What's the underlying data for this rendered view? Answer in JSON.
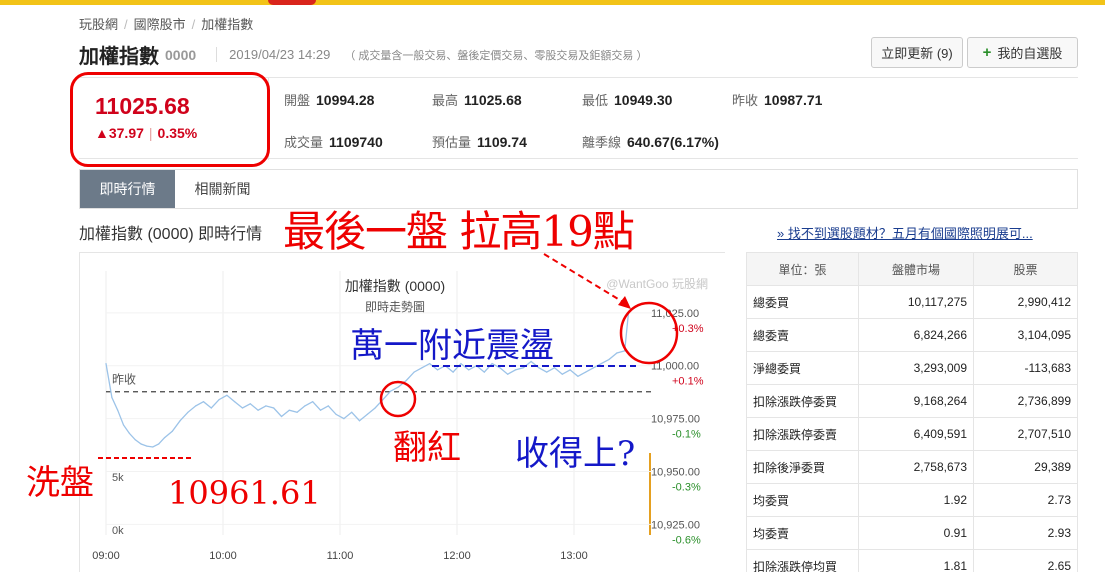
{
  "breadcrumb": [
    "玩股網",
    "國際股市",
    "加權指數"
  ],
  "header": {
    "name": "加權指數",
    "code": "0000",
    "datetime": "2019/04/23 14:29",
    "note": "（ 成交量含一般交易、盤後定價交易、零股交易及鉅額交易 ）",
    "refresh_label": "立即更新 (9)",
    "add_label": "我的自選股"
  },
  "quote": {
    "price": "11025.68",
    "change": "▲37.97",
    "change_pct": "0.35%",
    "open_label": "開盤",
    "open": "10994.28",
    "high_label": "最高",
    "high": "11025.68",
    "low_label": "最低",
    "low": "10949.30",
    "prev_label": "昨收",
    "prev": "10987.71",
    "volume_label": "成交量",
    "volume": "1109740",
    "est_label": "預估量",
    "est": "1109.74",
    "season_label": "離季線",
    "season": "640.67(6.17%)"
  },
  "tabs": [
    "即時行情",
    "相關新聞"
  ],
  "section_title": "加權指數 (0000) 即時行情",
  "promo_link": "» 找不到選股題材？五月有個國際照明展可...",
  "table": {
    "headers": [
      "單位：張",
      "盤體市場",
      "股票"
    ],
    "rows": [
      [
        "總委買",
        "10,117,275",
        "2,990,412"
      ],
      [
        "總委賣",
        "6,824,266",
        "3,104,095"
      ],
      [
        "淨總委買",
        "3,293,009",
        "-113,683"
      ],
      [
        "扣除漲跌停委買",
        "9,168,264",
        "2,736,899"
      ],
      [
        "扣除漲跌停委賣",
        "6,409,591",
        "2,707,510"
      ],
      [
        "扣除後淨委買",
        "2,758,673",
        "29,389"
      ],
      [
        "均委買",
        "1.92",
        "2.73"
      ],
      [
        "均委賣",
        "0.91",
        "2.93"
      ],
      [
        "扣除漲跌停均買",
        "1.81",
        "2.65"
      ]
    ]
  },
  "annotations": {
    "headline": "最後一盤 拉高19點",
    "range": "萬一附近震盪",
    "turn_red": "翻紅",
    "hold": "收得上?",
    "washout": "洗盤",
    "low_value": "10961.61"
  },
  "chart_data": {
    "type": "line",
    "title": "加權指數 (0000)",
    "subtitle": "即時走勢圖",
    "watermark": "@WantGoo 玩股網",
    "prev_close_label": "昨收",
    "prev_close": 10987.71,
    "x_ticks": [
      "09:00",
      "10:00",
      "11:00",
      "12:00",
      "13:00"
    ],
    "y_ticks": [
      {
        "value": 11025,
        "label": "11,025.00",
        "pct": "+0.3%"
      },
      {
        "value": 11000,
        "label": "11,000.00",
        "pct": "+0.1%"
      },
      {
        "value": 10975,
        "label": "10,975.00",
        "pct": "-0.1%"
      },
      {
        "value": 10950,
        "label": "10,950.00",
        "pct": "-0.3%"
      },
      {
        "value": 10925,
        "label": "10,925.00",
        "pct": "-0.6%"
      }
    ],
    "volume_ticks": [
      "5k",
      "0k"
    ],
    "ylim": [
      10920,
      11032
    ],
    "xlim_minutes": [
      0,
      280
    ],
    "series": [
      {
        "values": [
          [
            0,
            11001
          ],
          [
            3,
            10985
          ],
          [
            6,
            10979
          ],
          [
            9,
            10972
          ],
          [
            12,
            10968
          ],
          [
            15,
            10965
          ],
          [
            18,
            10963
          ],
          [
            21,
            10962
          ],
          [
            24,
            10961.61
          ],
          [
            27,
            10963
          ],
          [
            30,
            10966
          ],
          [
            34,
            10969
          ],
          [
            38,
            10974
          ],
          [
            42,
            10978
          ],
          [
            46,
            10981
          ],
          [
            50,
            10983
          ],
          [
            54,
            10980
          ],
          [
            58,
            10984
          ],
          [
            62,
            10986
          ],
          [
            66,
            10983
          ],
          [
            70,
            10980
          ],
          [
            74,
            10982
          ],
          [
            78,
            10979
          ],
          [
            82,
            10981
          ],
          [
            86,
            10980
          ],
          [
            90,
            10976
          ],
          [
            94,
            10979
          ],
          [
            98,
            10978
          ],
          [
            102,
            10981
          ],
          [
            106,
            10983
          ],
          [
            110,
            10979
          ],
          [
            114,
            10981
          ],
          [
            118,
            10977
          ],
          [
            122,
            10975
          ],
          [
            126,
            10978
          ],
          [
            130,
            10974
          ],
          [
            134,
            10977
          ],
          [
            138,
            10980
          ],
          [
            142,
            10984
          ],
          [
            146,
            10988
          ],
          [
            150,
            10990
          ],
          [
            154,
            10993
          ],
          [
            158,
            10997
          ],
          [
            162,
            10999
          ],
          [
            166,
            11001
          ],
          [
            170,
            10998
          ],
          [
            174,
            11000
          ],
          [
            178,
            10997
          ],
          [
            182,
            11001
          ],
          [
            186,
            10998
          ],
          [
            190,
            11000
          ],
          [
            194,
            10997
          ],
          [
            198,
            11001
          ],
          [
            202,
            10999
          ],
          [
            206,
            10996
          ],
          [
            210,
            10998
          ],
          [
            214,
            10999
          ],
          [
            218,
            11002
          ],
          [
            222,
            10999
          ],
          [
            226,
            10997
          ],
          [
            230,
            10999
          ],
          [
            234,
            10996
          ],
          [
            238,
            10998
          ],
          [
            242,
            10995
          ],
          [
            246,
            10997
          ],
          [
            250,
            10999
          ],
          [
            254,
            11001
          ],
          [
            258,
            11003
          ],
          [
            262,
            11006
          ],
          [
            266,
            11007
          ],
          [
            268,
            11025.68
          ]
        ],
        "color": "#9cc3e8"
      }
    ]
  },
  "colors": {
    "up": "#d0021b",
    "down": "#2a8f2a",
    "annotation_red": "#e00000",
    "annotation_blue": "#1418c8",
    "line": "#9cc3e8"
  }
}
